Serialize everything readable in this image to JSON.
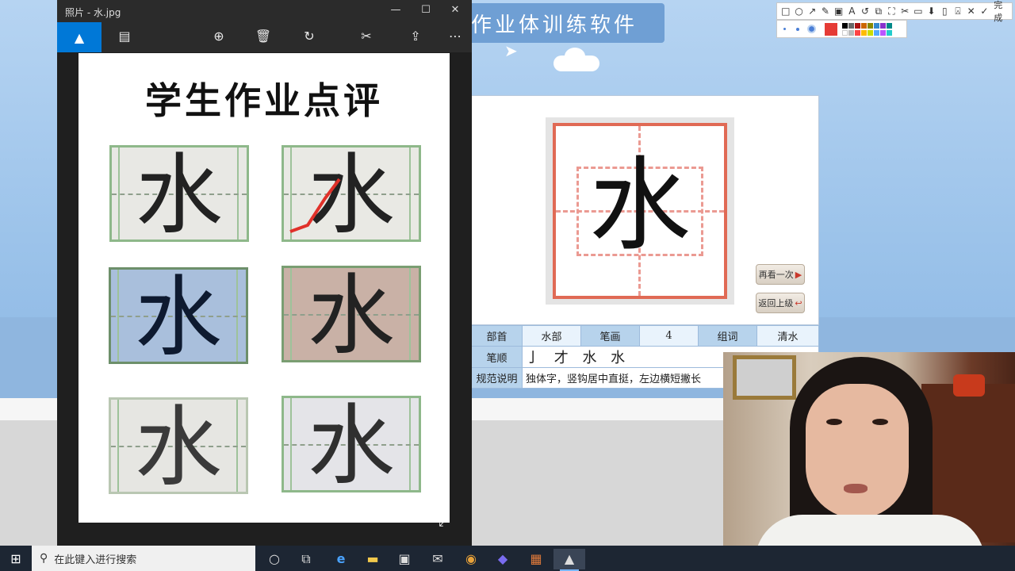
{
  "app": {
    "banner_title": "作业体训练软件",
    "character": "水",
    "buttons": {
      "replay": "再看一次",
      "back": "返回上级"
    },
    "info": {
      "radical_label": "部首",
      "radical_value": "水部",
      "strokes_label": "笔画",
      "strokes_value": "4",
      "words_label": "组词",
      "words_value": "清水",
      "order_label": "笔顺",
      "order_value": "亅 才 水 水",
      "norm_label": "规范说明",
      "norm_value": "独体字，竖钩居中直挺，左边横短撇长"
    }
  },
  "annotate_toolbar": {
    "icons": [
      "square-icon",
      "circle-icon",
      "arrow-icon",
      "pen-icon",
      "mosaic-icon",
      "text-icon",
      "undo-icon",
      "crop-icon",
      "expand-icon",
      "pin-icon",
      "copy-icon",
      "save-icon",
      "download-icon",
      "bookmark-icon",
      "close-icon",
      "check-icon"
    ],
    "glyphs": [
      "□",
      "○",
      "↗",
      "✎",
      "▣",
      "A",
      "↺",
      "⧉",
      "⛶",
      "✂",
      "▭",
      "⬇",
      "▯",
      "⍓",
      "✕",
      "✓"
    ],
    "done_label": "完成",
    "active_color": "#e53b35"
  },
  "photo_viewer": {
    "window_title": "照片 - 水.jpg",
    "controls": {
      "minimize": "—",
      "maximize": "☐",
      "close": "✕"
    },
    "document_title": "学生作业点评",
    "sample_character": "水",
    "toolbar_glyphs": {
      "picture": "▲",
      "slideshow": "▤",
      "zoom": "⊕",
      "delete": "🗑",
      "rotate": "↻",
      "edit": "✂",
      "share": "⇪",
      "more": "⋯",
      "expand": "⤢"
    }
  },
  "taskbar": {
    "start_glyph": "⊞",
    "search_glyph": "⚲",
    "search_placeholder": "在此键入进行搜索",
    "apps": [
      {
        "name": "cortana-icon",
        "glyph": "○"
      },
      {
        "name": "task-view-icon",
        "glyph": "⧉"
      },
      {
        "name": "edge-icon",
        "glyph": "e"
      },
      {
        "name": "file-explorer-icon",
        "glyph": "▬"
      },
      {
        "name": "store-icon",
        "glyph": "▣"
      },
      {
        "name": "mail-icon",
        "glyph": "✉"
      },
      {
        "name": "chrome-icon",
        "glyph": "◉"
      },
      {
        "name": "app-icon",
        "glyph": "◆"
      },
      {
        "name": "game-icon",
        "glyph": "▦"
      },
      {
        "name": "photos-icon",
        "glyph": "▲"
      }
    ]
  }
}
